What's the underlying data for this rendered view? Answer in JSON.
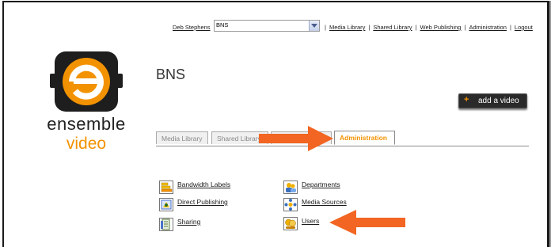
{
  "header": {
    "user_name": "Deb Stephens",
    "workspace_value": "BNS",
    "links": [
      "Media Library",
      "Shared Library",
      "Web Publishing",
      "Administration",
      "Logout"
    ]
  },
  "brand": {
    "line1": "ensemble",
    "line2": "video",
    "accent": "#f39200"
  },
  "workspace_title": "BNS",
  "add_video_label": "add a video",
  "tabs": [
    {
      "label": "Media Library"
    },
    {
      "label": "Shared Library"
    },
    {
      "label": "Web Publishing"
    },
    {
      "label": "Administration",
      "active": true
    }
  ],
  "admin_items": [
    {
      "label": "Bandwidth Labels",
      "icon": "stack-icon"
    },
    {
      "label": "Direct Publishing",
      "icon": "publish-icon"
    },
    {
      "label": "Sharing",
      "icon": "sharing-icon"
    },
    {
      "label": "Departments",
      "icon": "departments-icon"
    },
    {
      "label": "Media Sources",
      "icon": "media-sources-icon"
    },
    {
      "label": "Users",
      "icon": "users-icon"
    }
  ],
  "annotation_color": "#f26522"
}
